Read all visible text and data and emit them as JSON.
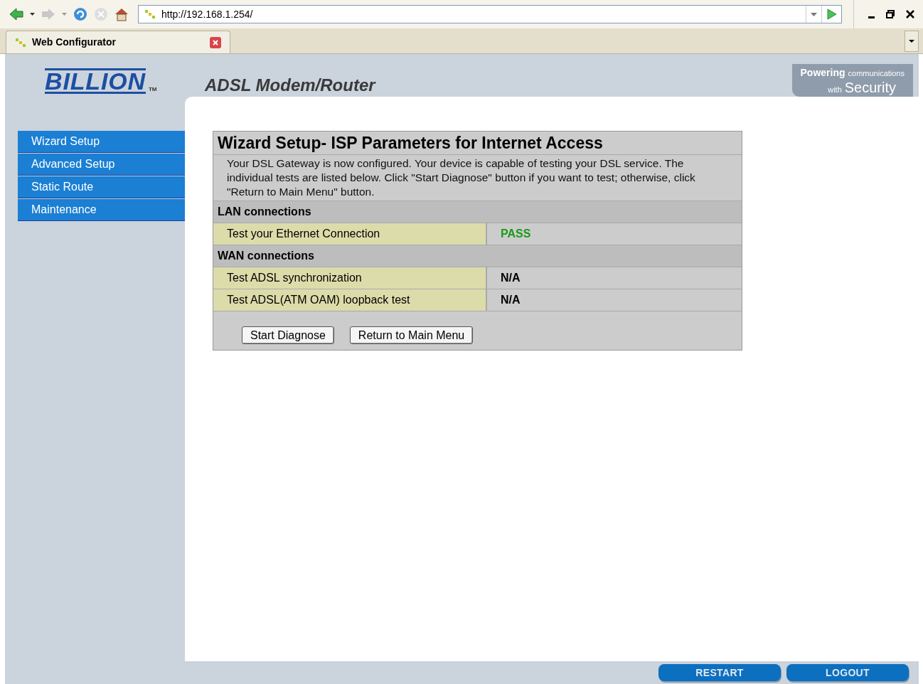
{
  "browser": {
    "url": "http://192.168.1.254/",
    "tab_title": "Web Configurator"
  },
  "brand": {
    "logo": "BILLION",
    "trademark": "TM",
    "product": "ADSL Modem/Router",
    "tagline_top": [
      "Powering",
      "communications"
    ],
    "tagline_bottom": [
      "with",
      "Security"
    ]
  },
  "sidebar": {
    "items": [
      {
        "label": "Wizard Setup"
      },
      {
        "label": "Advanced Setup"
      },
      {
        "label": "Static Route"
      },
      {
        "label": "Maintenance"
      }
    ]
  },
  "panel": {
    "title": "Wizard Setup- ISP Parameters for Internet Access",
    "description": "Your DSL Gateway is now configured. Your device is capable of testing your DSL service. The individual tests are listed below. Click \"Start Diagnose\" button if you want to test; otherwise, click \"Return to Main Menu\" button.",
    "sections": [
      {
        "heading": "LAN connections",
        "tests": [
          {
            "label": "Test your Ethernet Connection",
            "result": "PASS",
            "kind": "pass"
          }
        ]
      },
      {
        "heading": "WAN connections",
        "tests": [
          {
            "label": "Test ADSL synchronization",
            "result": "N/A",
            "kind": "none"
          },
          {
            "label": "Test ADSL(ATM OAM) loopback test",
            "result": "N/A",
            "kind": "none"
          }
        ]
      }
    ],
    "buttons": [
      "Start Diagnose",
      "Return to Main Menu"
    ]
  },
  "footer_buttons": [
    "RESTART",
    "LOGOUT"
  ]
}
